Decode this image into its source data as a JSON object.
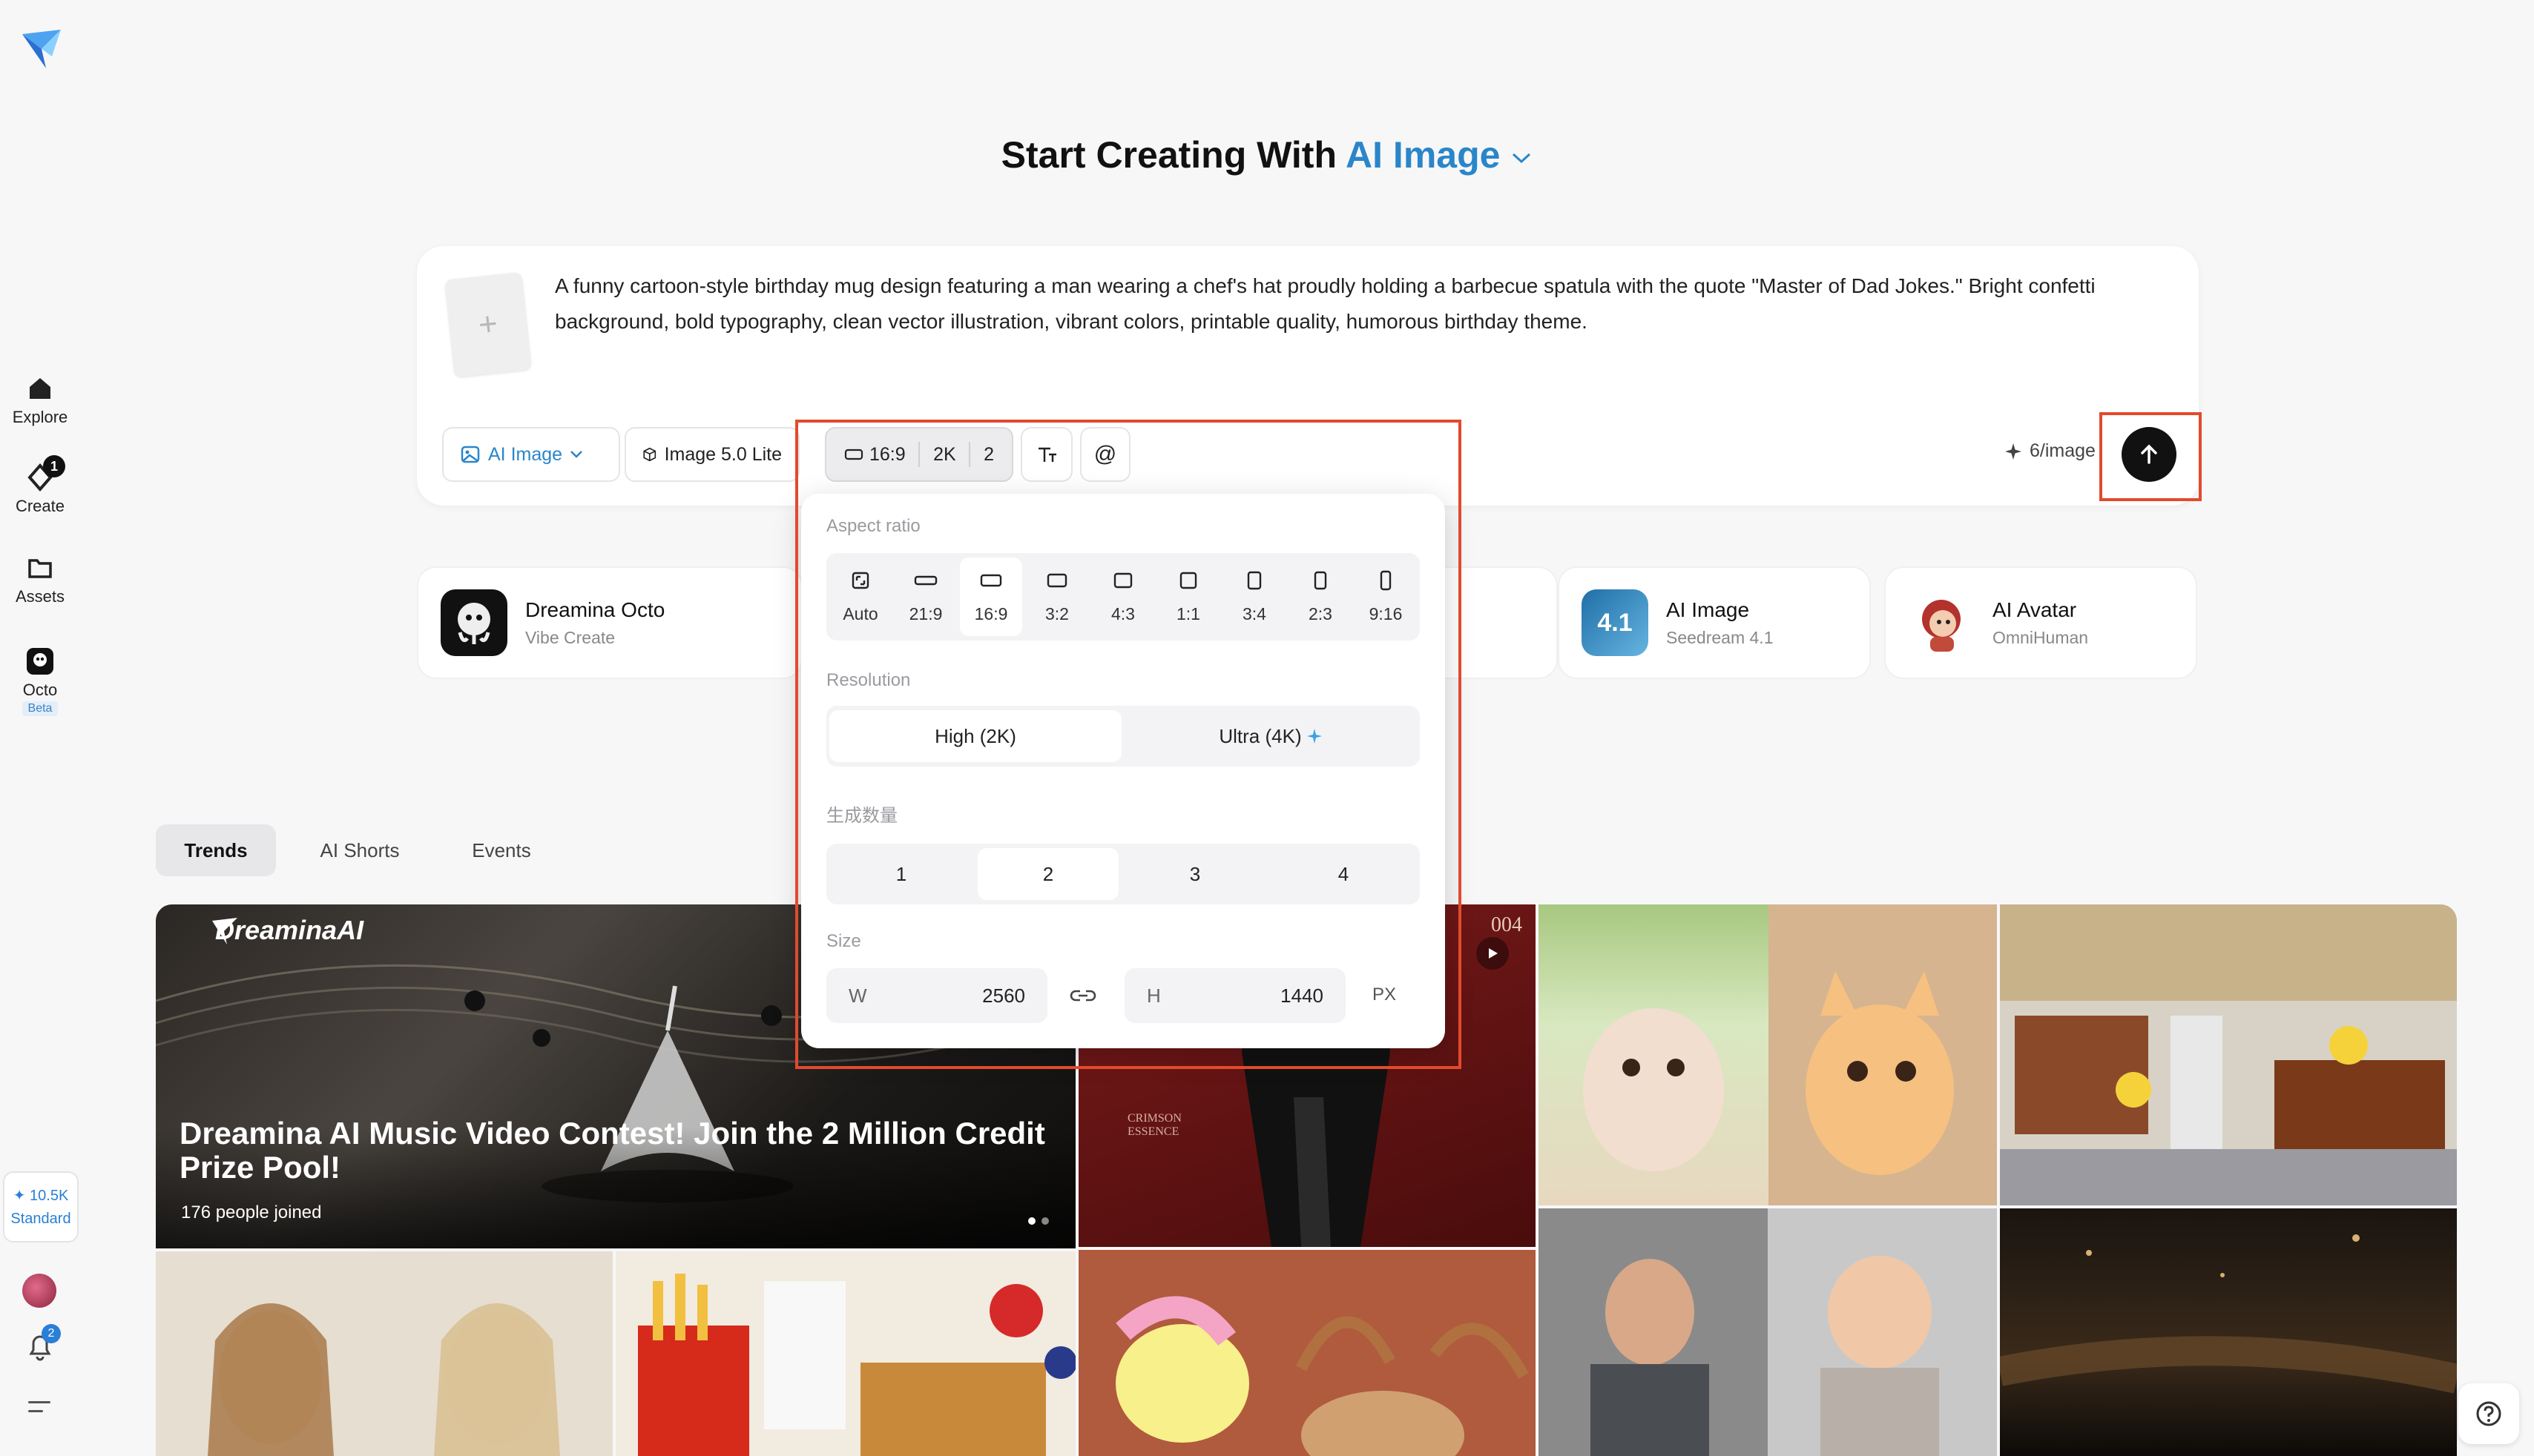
{
  "sidebar": {
    "items": [
      {
        "label": "Explore"
      },
      {
        "label": "Create",
        "badge": "1"
      },
      {
        "label": "Assets"
      },
      {
        "label": "Octo",
        "tag": "Beta"
      }
    ],
    "credits": {
      "amount": "10.5K",
      "plan": "Standard"
    },
    "notifications_badge": "2"
  },
  "header": {
    "title_prefix": "Start Creating With",
    "title_accent": "AI Image"
  },
  "prompt": {
    "text": "A funny cartoon-style birthday mug design featuring a man wearing a chef's hat proudly holding a barbecue spatula with the quote \"Master of Dad Jokes.\" Bright confetti background, bold typography, clean vector illustration, vibrant colors, printable quality, humorous birthday theme.",
    "add_symbol": "+"
  },
  "toolbar": {
    "mode_label": "AI Image",
    "model_label": "Image 5.0 Lite",
    "ratio_label": "16:9",
    "resolution_label": "2K",
    "count_label": "2",
    "mention_label": "@",
    "cost_label": "6/image"
  },
  "popover": {
    "aspect_ratio_label": "Aspect ratio",
    "ratios": [
      "Auto",
      "21:9",
      "16:9",
      "3:2",
      "4:3",
      "1:1",
      "3:4",
      "2:3",
      "9:16"
    ],
    "selected_ratio": "16:9",
    "resolution_label": "Resolution",
    "resolutions": [
      "High (2K)",
      "Ultra (4K)"
    ],
    "count_label": "生成数量",
    "counts": [
      "1",
      "2",
      "3",
      "4"
    ],
    "selected_count": "2",
    "size_label": "Size",
    "width_key": "W",
    "width_value": "2560",
    "height_key": "H",
    "height_value": "1440",
    "unit": "PX"
  },
  "features": [
    {
      "title": "Dreamina Octo",
      "subtitle": "Vibe Create"
    },
    {
      "title": "AI Image",
      "subtitle": "Seedream 4.1",
      "icon_text": "4.1"
    },
    {
      "title": "AI Avatar",
      "subtitle": "OmniHuman"
    }
  ],
  "tabs": [
    {
      "label": "Trends",
      "active": true
    },
    {
      "label": "AI Shorts"
    },
    {
      "label": "Events"
    }
  ],
  "hero": {
    "brand": "DreaminaAI",
    "title": "Dreamina AI Music Video Contest! Join the 2 Million Credit Prize Pool!",
    "participants": "176 people joined",
    "corner_tag": "004"
  },
  "book": {
    "title": "CRIMSON ESSENCE"
  },
  "colors": {
    "accent": "#2a86c9",
    "highlight_box": "#e24a2d",
    "send_button": "#111111"
  }
}
